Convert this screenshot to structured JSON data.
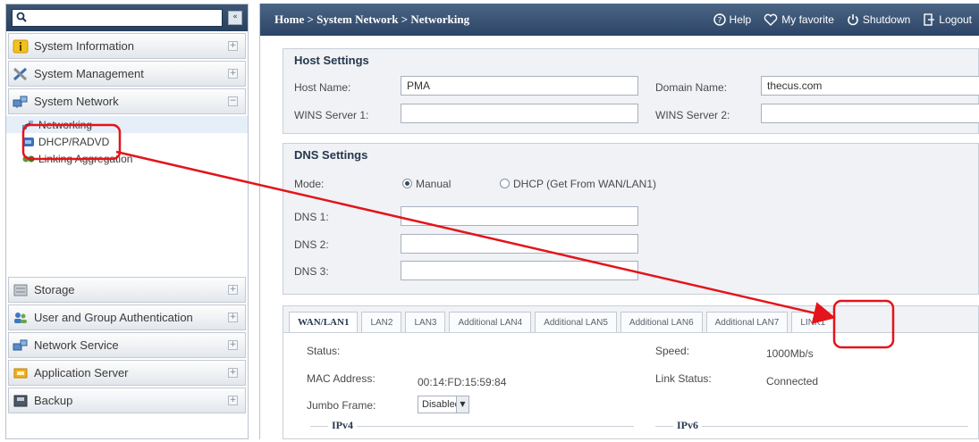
{
  "sidebar": {
    "search_placeholder": "",
    "collapse_label": "«",
    "sections_top": [
      {
        "label": "System Information",
        "icon": "info-icon"
      },
      {
        "label": "System Management",
        "icon": "tools-icon"
      },
      {
        "label": "System Network",
        "icon": "network-icon"
      }
    ],
    "network_items": [
      {
        "label": "Networking",
        "icon": "networking-icon"
      },
      {
        "label": "DHCP/RADVD",
        "icon": "dhcp-icon"
      },
      {
        "label": "Linking Aggregation",
        "icon": "aggregation-icon"
      }
    ],
    "sections_bottom": [
      {
        "label": "Storage",
        "icon": "storage-icon"
      },
      {
        "label": "User and Group Authentication",
        "icon": "users-icon"
      },
      {
        "label": "Network Service",
        "icon": "service-icon"
      },
      {
        "label": "Application Server",
        "icon": "app-server-icon"
      },
      {
        "label": "Backup",
        "icon": "backup-icon"
      }
    ]
  },
  "header": {
    "breadcrumb": "Home > System Network > Networking",
    "help": "Help",
    "favorite": "My favorite",
    "shutdown": "Shutdown",
    "logout": "Logout"
  },
  "host": {
    "title": "Host Settings",
    "host_name_label": "Host Name:",
    "host_name_value": "PMA",
    "domain_name_label": "Domain Name:",
    "domain_name_value": "thecus.com",
    "wins1_label": "WINS Server 1:",
    "wins1_value": "",
    "wins2_label": "WINS Server 2:",
    "wins2_value": ""
  },
  "dns": {
    "title": "DNS Settings",
    "mode_label": "Mode:",
    "mode_manual": "Manual",
    "mode_dhcp": "DHCP (Get From WAN/LAN1)",
    "mode_selected": "Manual",
    "dns1_label": "DNS 1:",
    "dns2_label": "DNS 2:",
    "dns3_label": "DNS 3:"
  },
  "tabs": [
    "WAN/LAN1",
    "LAN2",
    "LAN3",
    "Additional LAN4",
    "Additional LAN5",
    "Additional LAN6",
    "Additional LAN7",
    "LINK1"
  ],
  "wan": {
    "status_label": "Status:",
    "speed_label": "Speed:",
    "speed_value": "1000Mb/s",
    "mac_label": "MAC Address:",
    "mac_value": "00:14:FD:15:59:84",
    "link_status_label": "Link Status:",
    "link_status_value": "Connected",
    "jumbo_label": "Jumbo Frame:",
    "jumbo_value": "Disabled",
    "ipv4_label": "IPv4",
    "ipv6_label": "IPv6"
  },
  "colors": {
    "annotation": "#e3141b",
    "header_bg": "#2c4566"
  }
}
